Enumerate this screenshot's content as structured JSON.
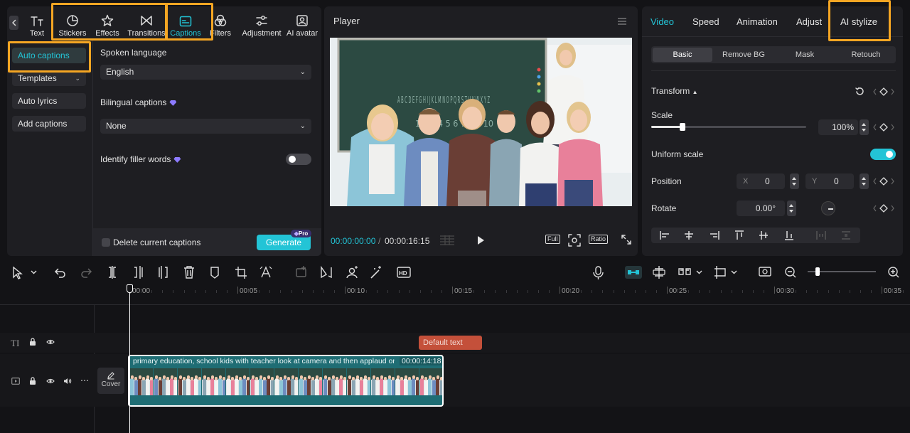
{
  "left_tabs": [
    {
      "label": "Text",
      "icon": "text-icon"
    },
    {
      "label": "Stickers",
      "icon": "sticker-icon"
    },
    {
      "label": "Effects",
      "icon": "effects-icon"
    },
    {
      "label": "Transitions",
      "icon": "transitions-icon"
    },
    {
      "label": "Captions",
      "icon": "captions-icon",
      "active": true
    },
    {
      "label": "Filters",
      "icon": "filters-icon"
    },
    {
      "label": "Adjustment",
      "icon": "adjustment-icon"
    },
    {
      "label": "AI avatar",
      "icon": "ai-avatar-icon"
    }
  ],
  "caption_nav": [
    {
      "label": "Auto captions",
      "active": true
    },
    {
      "label": "Templates",
      "has_chevron": true
    },
    {
      "label": "Auto lyrics"
    },
    {
      "label": "Add captions"
    }
  ],
  "captions_panel": {
    "spoken_language_label": "Spoken language",
    "spoken_language_value": "English",
    "bilingual_label": "Bilingual captions",
    "bilingual_value": "None",
    "filler_label": "Identify filler words",
    "delete_label": "Delete current captions",
    "generate_label": "Generate",
    "pro_badge": "Pro"
  },
  "player": {
    "title": "Player",
    "current_time": "00:00:00:00",
    "separator": "/",
    "total_time": "00:00:16:15",
    "full_label": "Full",
    "ratio_label": "Ratio",
    "chalkboard_text": "A B C D E F G H I J K L M N O P Q R S T U V W X Y Z",
    "chalk_numbers": "1 2 3 4 5 6 7 8 9 10"
  },
  "right_tabs": [
    {
      "label": "Video",
      "active": true
    },
    {
      "label": "Speed"
    },
    {
      "label": "Animation"
    },
    {
      "label": "Adjust"
    },
    {
      "label": "AI stylize"
    }
  ],
  "video_subtabs": [
    "Basic",
    "Remove BG",
    "Mask",
    "Retouch"
  ],
  "transform": {
    "section_label": "Transform",
    "scale_label": "Scale",
    "scale_value": "100%",
    "scale_fraction": 0.2,
    "uniform_label": "Uniform scale",
    "uniform_on": true,
    "position_label": "Position",
    "x_label": "X",
    "x_value": "0",
    "y_label": "Y",
    "y_value": "0",
    "rotate_label": "Rotate",
    "rotate_value": "0.00°"
  },
  "timeline": {
    "ticks": [
      "00:00",
      "00:05",
      "00:10",
      "00:15",
      "00:20",
      "00:25",
      "00:30",
      "00:35"
    ],
    "text_clip_label": "Default text",
    "video_clip_title": "primary education, school kids with teacher look at camera and then applaud on",
    "video_clip_duration": "00:00:14:18",
    "cover_label": "Cover",
    "zoom_fraction": 0.15
  },
  "colors": {
    "accent": "#23c4d6",
    "highlight": "#f5a623",
    "text_clip": "#c4503a",
    "video_clip": "#1f6d74"
  }
}
